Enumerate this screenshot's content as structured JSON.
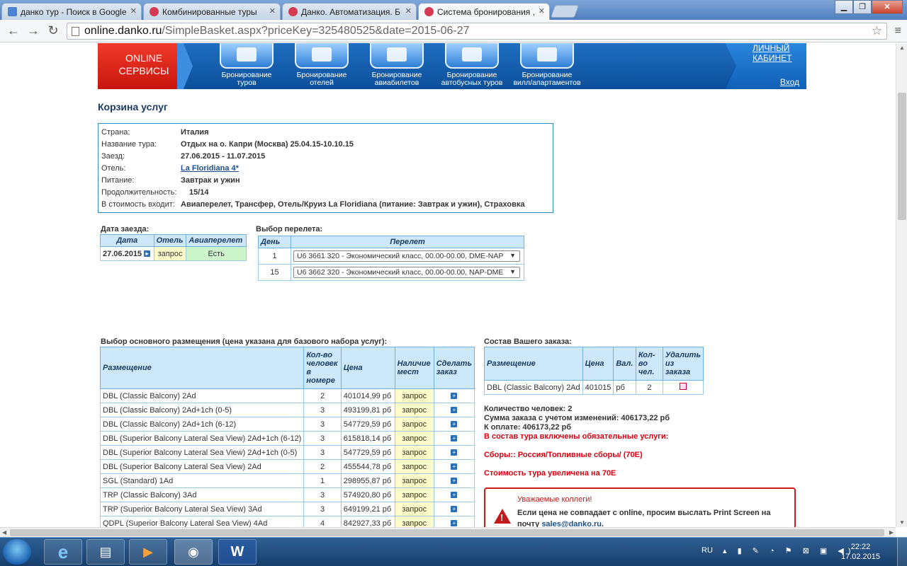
{
  "browser": {
    "tabs": [
      {
        "title": "данко тур - Поиск в Google",
        "color": "#4a84d4"
      },
      {
        "title": "Комбинированные туры",
        "color": "#d63a52"
      },
      {
        "title": "Данко. Автоматизация. Б",
        "color": "#d63a52"
      },
      {
        "title": "Система бронирования ,",
        "color": "#d63a52",
        "active": true
      }
    ],
    "url_host": "online.danko.ru",
    "url_path": "/SimpleBasket.aspx?priceKey=325480525&date=2015-06-27"
  },
  "banner": {
    "online_line1": "ONLINE",
    "online_line2": "СЕРВИСЫ",
    "services": [
      {
        "line1": "Бронирование",
        "line2": "туров"
      },
      {
        "line1": "Бронирование",
        "line2": "отелей"
      },
      {
        "line1": "Бронирование",
        "line2": "авиабилетов"
      },
      {
        "line1": "Бронирование",
        "line2": "автобусных туров"
      },
      {
        "line1": "Бронирование",
        "line2": "вилл/апартаментов"
      }
    ],
    "cabinet_line1": "ЛИЧНЫЙ",
    "cabinet_line2": "КАБИНЕТ",
    "login": "Вход"
  },
  "page_title": "Корзина услуг",
  "info": [
    {
      "label": "Страна:",
      "value": "Италия"
    },
    {
      "label": "Название тура:",
      "value": "Отдых на о. Капри (Москва) 25.04.15-10.10.15"
    },
    {
      "label": "Заезд:",
      "value": "27.06.2015 - 11.07.2015"
    },
    {
      "label": "Отель:",
      "value": "La Floridiana 4*"
    },
    {
      "label": "Питание:",
      "value": "Завтрак и ужин"
    },
    {
      "label": "Продолжительность:",
      "value": "15/14"
    },
    {
      "label": "В стоимость входит:",
      "value": "Авиаперелет, Трансфер, Отель/Круиз La Floridiana (питание: Завтрак и ужин), Страховка"
    }
  ],
  "checkin": {
    "title": "Дата заезда:",
    "headers": [
      "Дата",
      "Отель",
      "Авиаперелет"
    ],
    "row": {
      "date": "27.06.2015",
      "hotel": "запрос",
      "flight": "Есть"
    }
  },
  "flight": {
    "title": "Выбор перелета:",
    "headers": [
      "День",
      "Перелет"
    ],
    "rows": [
      {
        "day": "1",
        "value": "U6 3661 320 - Экономический класс, 00.00-00.00, DME-NAP"
      },
      {
        "day": "15",
        "value": "U6 3662 320 - Экономический класс, 00.00-00.00, NAP-DME"
      }
    ]
  },
  "accommodation": {
    "title": "Выбор основного размещения (цена указана для базового набора услуг):",
    "headers": [
      "Размещение",
      "Кол-во человек в номере",
      "Цена",
      "Наличие мест",
      "Сделать заказ"
    ],
    "rows": [
      {
        "name": "DBL (Classic Balcony) 2Ad",
        "qty": "2",
        "price": "401014,99 рб",
        "avail": "запрос"
      },
      {
        "name": "DBL (Classic Balcony) 2Ad+1ch (0-5)",
        "qty": "3",
        "price": "493199,81 рб",
        "avail": "запрос"
      },
      {
        "name": "DBL (Classic Balcony) 2Ad+1ch (6-12)",
        "qty": "3",
        "price": "547729,59 рб",
        "avail": "запрос"
      },
      {
        "name": "DBL (Superior Balcony Lateral Sea View) 2Ad+1ch (6-12)",
        "qty": "3",
        "price": "615818,14 рб",
        "avail": "запрос"
      },
      {
        "name": "DBL (Superior Balcony Lateral Sea View) 2Ad+1ch (0-5)",
        "qty": "3",
        "price": "547729,59 рб",
        "avail": "запрос"
      },
      {
        "name": "DBL (Superior Balcony Lateral Sea View) 2Ad",
        "qty": "2",
        "price": "455544,78 рб",
        "avail": "запрос"
      },
      {
        "name": "SGL (Standard) 1Ad",
        "qty": "1",
        "price": "298955,87 рб",
        "avail": "запрос"
      },
      {
        "name": "TRP (Classic Balcony) 3Ad",
        "qty": "3",
        "price": "574920,80 рб",
        "avail": "запрос"
      },
      {
        "name": "TRP (Superior Balcony Lateral Sea View) 3Ad",
        "qty": "3",
        "price": "649199,21 рб",
        "avail": "запрос"
      },
      {
        "name": "QDPL (Superior Balcony Lateral Sea View) 4Ad",
        "qty": "4",
        "price": "842927,33 рб",
        "avail": "запрос"
      }
    ]
  },
  "order": {
    "title": "Состав Вашего заказа:",
    "headers": [
      "Размещение",
      "Цена",
      "Вал.",
      "Кол-во чел.",
      "Удалить из заказа"
    ],
    "row": {
      "name": "DBL (Classic Balcony) 2Ad",
      "price": "401015",
      "cur": "рб",
      "qty": "2"
    },
    "people": "Количество человек: 2",
    "sum": "Сумма заказа с учетом изменений:   406173,22 рб",
    "pay": "К оплате:   406173,22 рб",
    "included": "В состав тура включены обязательные услуги:",
    "fees": "Сборы:: Россия/Топливные сборы/ (70E)",
    "increase": "Стоимость тура увеличена на 70E"
  },
  "warning": {
    "title": "Уважаемые коллеги!",
    "text": "Если цена не совпадает с online, просим выслать Print Screen на почту ",
    "email": "sales@danko.ru",
    "tail": "."
  },
  "taskbar": {
    "lang": "RU",
    "time": "22:22",
    "date": "17.02.2015"
  }
}
